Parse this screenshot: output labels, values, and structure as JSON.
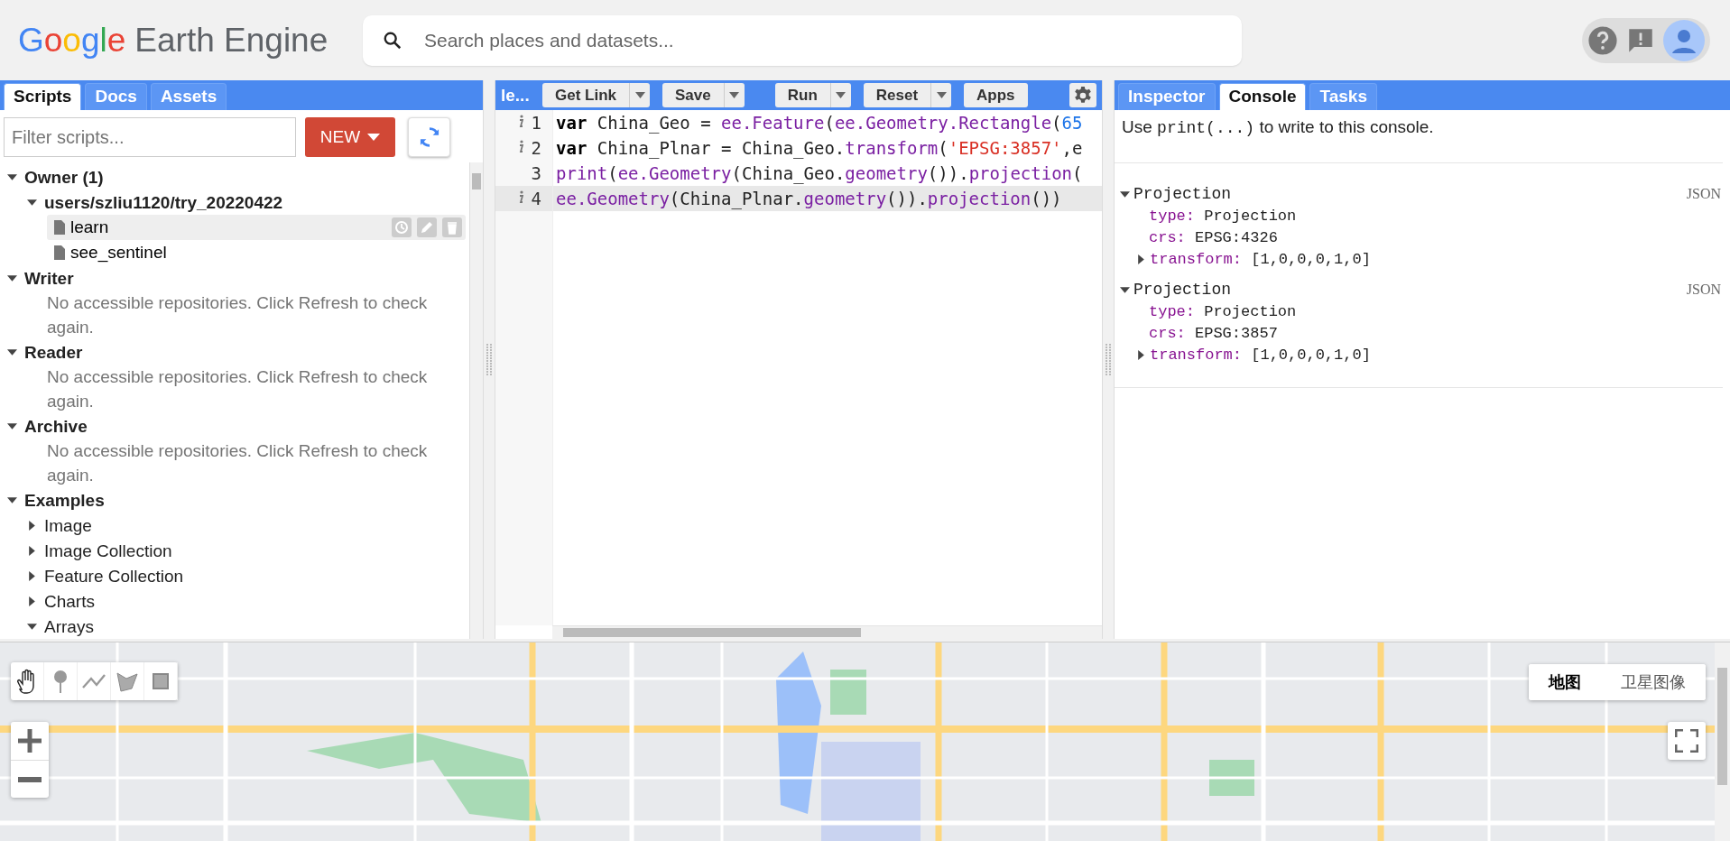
{
  "header": {
    "logo": {
      "brand": "Google",
      "product": "Earth Engine"
    },
    "search": {
      "placeholder": "Search places and datasets..."
    }
  },
  "scripts_panel": {
    "tabs": [
      {
        "label": "Scripts",
        "selected": true
      },
      {
        "label": "Docs",
        "selected": false
      },
      {
        "label": "Assets",
        "selected": false
      }
    ],
    "filter": {
      "placeholder": "Filter scripts..."
    },
    "new_button": "NEW",
    "tree": [
      {
        "label": "Owner (1)",
        "expanded": true,
        "children": [
          {
            "label": "users/szliu1120/try_20220422",
            "expanded": true,
            "children": [
              {
                "label": "learn",
                "kind": "file",
                "selected": true
              },
              {
                "label": "see_sentinel",
                "kind": "file",
                "selected": false
              }
            ]
          }
        ]
      },
      {
        "label": "Writer",
        "expanded": true,
        "message": "No accessible repositories. Click Refresh to check again."
      },
      {
        "label": "Reader",
        "expanded": true,
        "message": "No accessible repositories. Click Refresh to check again."
      },
      {
        "label": "Archive",
        "expanded": true,
        "message": "No accessible repositories. Click Refresh to check again."
      },
      {
        "label": "Examples",
        "expanded": true,
        "children": [
          {
            "label": "Image",
            "expanded": false
          },
          {
            "label": "Image Collection",
            "expanded": false
          },
          {
            "label": "Feature Collection",
            "expanded": false
          },
          {
            "label": "Charts",
            "expanded": false
          },
          {
            "label": "Arrays",
            "expanded": true
          }
        ]
      }
    ]
  },
  "editor": {
    "title": "le...",
    "buttons": [
      {
        "label": "Get Link",
        "dropdown": true
      },
      {
        "label": "Save",
        "dropdown": true
      },
      {
        "label": "Run",
        "dropdown": true
      },
      {
        "label": "Reset",
        "dropdown": true
      },
      {
        "label": "Apps",
        "dropdown": false
      }
    ],
    "lines": [
      {
        "number": "1",
        "info": true,
        "active": false,
        "tokens": [
          {
            "text": "var",
            "kind": "keyword"
          },
          {
            "text": " China_Geo = ",
            "kind": "plain"
          },
          {
            "text": "ee.Feature",
            "kind": "call"
          },
          {
            "text": "(",
            "kind": "plain"
          },
          {
            "text": "ee.Geometry.Rectangle",
            "kind": "call"
          },
          {
            "text": "(",
            "kind": "plain"
          },
          {
            "text": "65",
            "kind": "number"
          }
        ]
      },
      {
        "number": "2",
        "info": true,
        "active": false,
        "tokens": [
          {
            "text": "var",
            "kind": "keyword"
          },
          {
            "text": " China_Plnar = China_Geo.",
            "kind": "plain"
          },
          {
            "text": "transform",
            "kind": "call"
          },
          {
            "text": "(",
            "kind": "plain"
          },
          {
            "text": "'EPSG:3857'",
            "kind": "string"
          },
          {
            "text": ",e",
            "kind": "plain"
          }
        ]
      },
      {
        "number": "3",
        "info": false,
        "active": false,
        "tokens": [
          {
            "text": "print",
            "kind": "call"
          },
          {
            "text": "(",
            "kind": "plain"
          },
          {
            "text": "ee.Geometry",
            "kind": "call"
          },
          {
            "text": "(China_Geo.",
            "kind": "plain"
          },
          {
            "text": "geometry",
            "kind": "call"
          },
          {
            "text": "()).",
            "kind": "plain"
          },
          {
            "text": "projection",
            "kind": "call"
          },
          {
            "text": "(",
            "kind": "plain"
          }
        ]
      },
      {
        "number": "4",
        "info": true,
        "active": true,
        "tokens": [
          {
            "text": "ee.Geometry",
            "kind": "call"
          },
          {
            "text": "(China_Plnar.",
            "kind": "plain"
          },
          {
            "text": "geometry",
            "kind": "call"
          },
          {
            "text": "()).",
            "kind": "plain"
          },
          {
            "text": "projection",
            "kind": "call"
          },
          {
            "text": "())",
            "kind": "plain"
          }
        ]
      }
    ]
  },
  "console_panel": {
    "tabs": [
      {
        "label": "Inspector",
        "selected": false
      },
      {
        "label": "Console",
        "selected": true
      },
      {
        "label": "Tasks",
        "selected": false
      }
    ],
    "hint": [
      {
        "text": "Use ",
        "kind": "plain"
      },
      {
        "text": "print(...)",
        "kind": "code"
      },
      {
        "text": " to write to this console.",
        "kind": "plain"
      }
    ],
    "entries": [
      {
        "title": "Projection",
        "expanded": true,
        "json_link": "JSON",
        "properties": [
          {
            "key": "type:",
            "value": "Projection",
            "expandable": false
          },
          {
            "key": "crs:",
            "value": "EPSG:4326",
            "expandable": false
          },
          {
            "key": "transform:",
            "value": "[1,0,0,0,1,0]",
            "expandable": true
          }
        ]
      },
      {
        "title": "Projection",
        "expanded": true,
        "json_link": "JSON",
        "properties": [
          {
            "key": "type:",
            "value": "Projection",
            "expandable": false
          },
          {
            "key": "crs:",
            "value": "EPSG:3857",
            "expandable": false
          },
          {
            "key": "transform:",
            "value": "[1,0,0,0,1,0]",
            "expandable": true
          }
        ]
      }
    ]
  },
  "map": {
    "map_types": [
      {
        "label": "地图",
        "selected": true
      },
      {
        "label": "卫星图像",
        "selected": false
      }
    ]
  }
}
